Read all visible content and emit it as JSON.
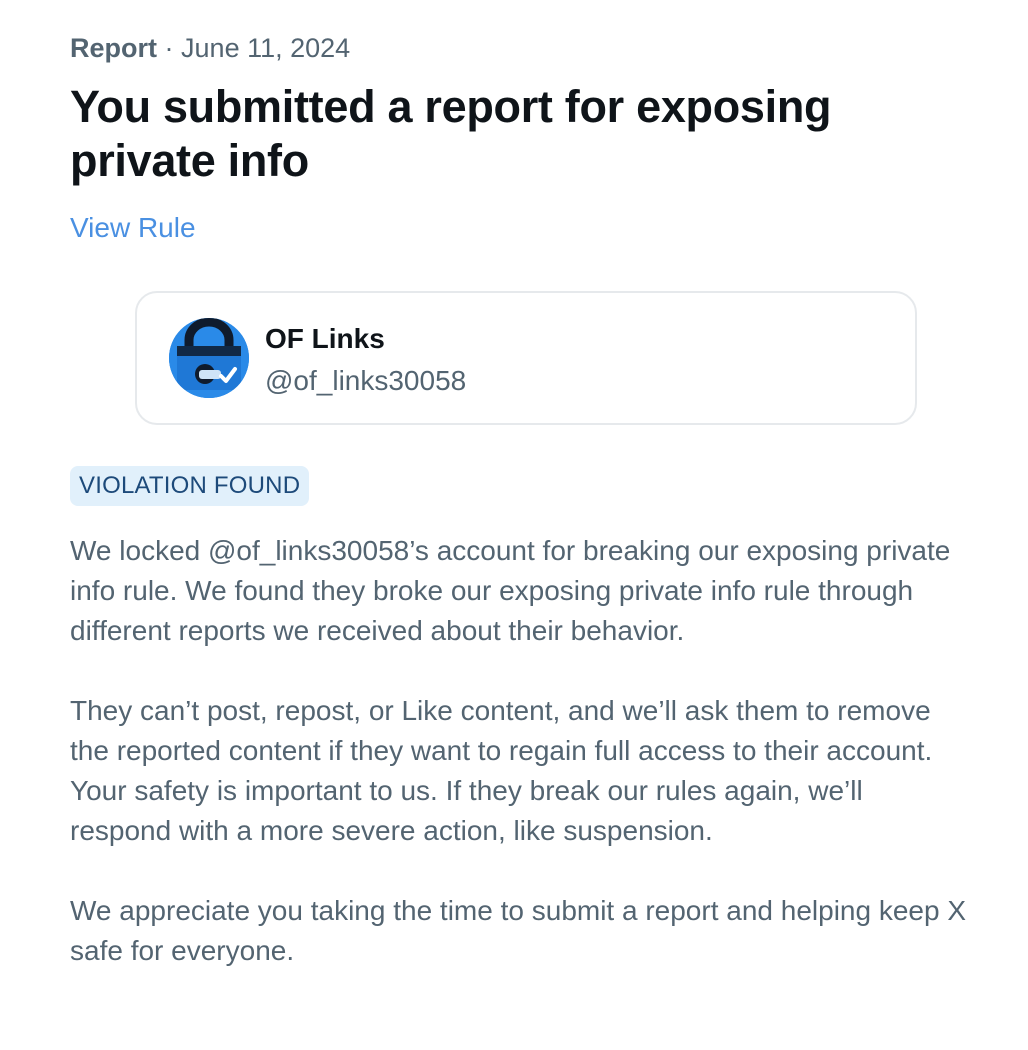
{
  "report": {
    "type_label": "Report",
    "separator": "·",
    "date": "June 11, 2024",
    "title": "You submitted a report for exposing private info",
    "view_rule_link": "View Rule"
  },
  "account": {
    "display_name": "OF Links",
    "handle": "@of_links30058",
    "avatar_icon": "lock-avatar-icon",
    "avatar_color": "#2a8ae8"
  },
  "status": {
    "badge": "VIOLATION FOUND",
    "badge_bg": "#e1f0fb",
    "badge_color": "#1d4a7a"
  },
  "message": {
    "paragraph_1": "We locked @of_links30058’s account for breaking our exposing private info rule. We found they broke our exposing private info rule through different reports we received about their behavior.",
    "paragraph_2": "They can’t post, repost, or Like content, and we’ll ask them to remove the reported content if they want to regain full access to their account. Your safety is important to us. If they break our rules again, we’ll respond with a more severe action, like suspension.",
    "paragraph_3": "We appreciate you taking the time to submit a report and helping keep X safe for everyone."
  },
  "colors": {
    "link": "#4a90e2",
    "heading": "#0f1419",
    "secondary_text": "#536471"
  }
}
